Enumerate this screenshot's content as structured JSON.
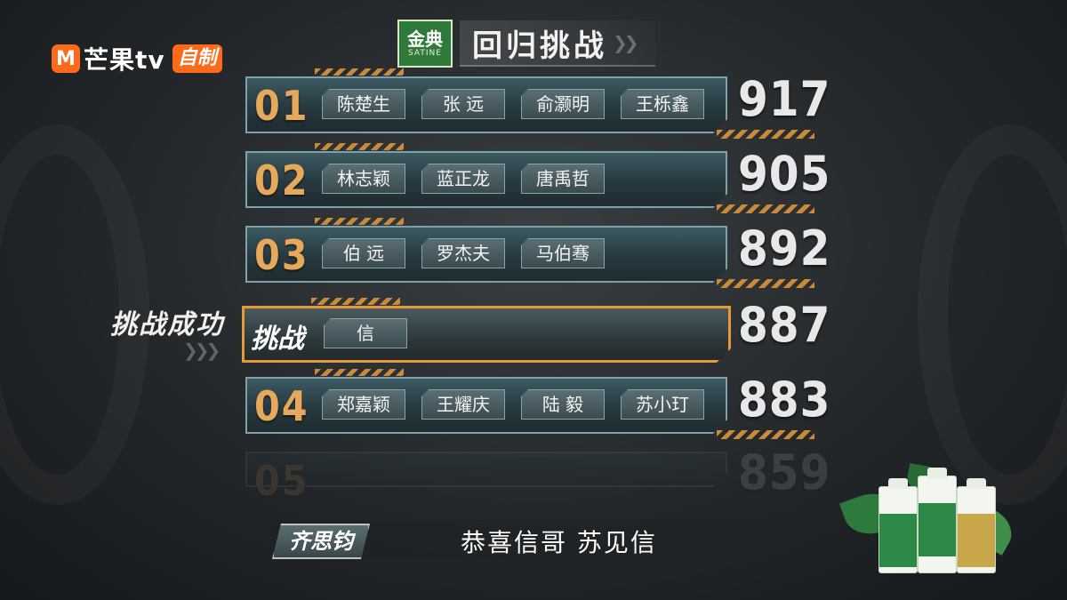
{
  "channel": {
    "logo_mark": "M",
    "name": "芒果tv",
    "badge": "自制"
  },
  "header": {
    "sponsor_main": "金典",
    "sponsor_sub": "SATINE",
    "title": "回归挑战"
  },
  "ranking": [
    {
      "rank": "01",
      "names": [
        "陈楚生",
        "张 远",
        "俞灏明",
        "王栎鑫"
      ],
      "score": "917"
    },
    {
      "rank": "02",
      "names": [
        "林志颖",
        "蓝正龙",
        "唐禹哲"
      ],
      "score": "905"
    },
    {
      "rank": "03",
      "names": [
        "伯 远",
        "罗杰夫",
        "马伯骞"
      ],
      "score": "892"
    },
    {
      "rank": "04",
      "names": [
        "郑嘉颖",
        "王耀庆",
        "陆 毅",
        "苏小玎"
      ],
      "score": "883"
    },
    {
      "rank": "05",
      "names": [
        "",
        "",
        ""
      ],
      "score": "859"
    }
  ],
  "challenger": {
    "label": "挑战",
    "names": [
      "信"
    ],
    "score": "887",
    "status": "挑战成功"
  },
  "caption": {
    "speaker": "齐思钧",
    "text": "恭喜信哥 苏见信"
  },
  "colors": {
    "accent_orange": "#e39a3b",
    "rank_gold": "#e6a85a",
    "panel_teal": "#3c5a62",
    "brand_orange": "#ff6a1a",
    "sponsor_green": "#2f7a3a"
  },
  "icons": [
    "chevron-right-icon",
    "logo-mark-icon",
    "product-carton-icon"
  ]
}
